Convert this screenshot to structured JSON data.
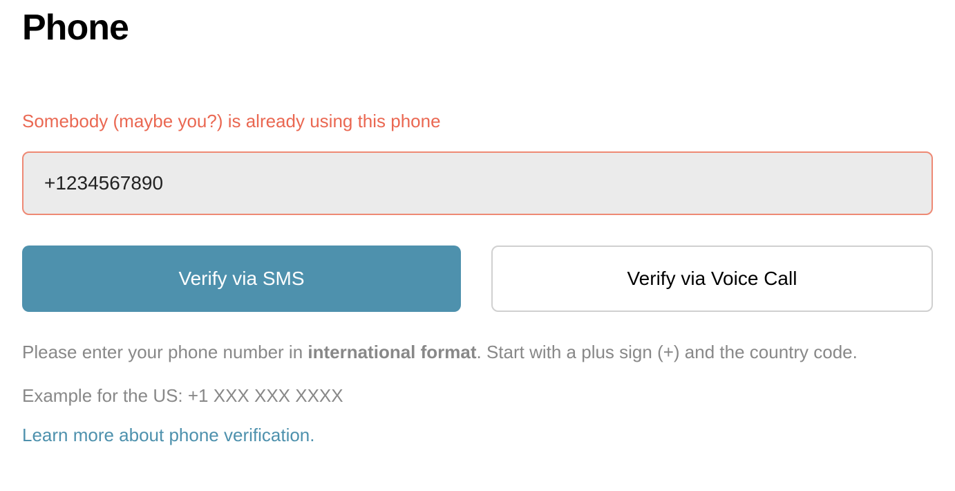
{
  "page": {
    "title": "Phone"
  },
  "error": {
    "message": "Somebody (maybe you?) is already using this phone"
  },
  "input": {
    "phone_value": "+1234567890"
  },
  "buttons": {
    "verify_sms_label": "Verify via SMS",
    "verify_voice_label": "Verify via Voice Call"
  },
  "help": {
    "prefix": "Please enter your phone number in ",
    "bold": "international format",
    "suffix": ". Start with a plus sign (+) and the country code.",
    "example": "Example for the US: +1 XXX XXX XXXX",
    "learn_more": "Learn more about phone verification."
  }
}
